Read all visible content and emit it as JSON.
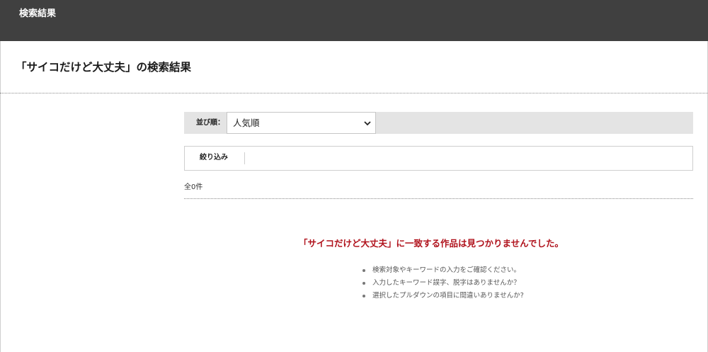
{
  "header": {
    "title": "検索結果"
  },
  "search": {
    "heading": "「サイコだけど大丈夫」の検索結果"
  },
  "sort": {
    "label": "並び順：",
    "selected": "人気順"
  },
  "filter": {
    "label": "絞り込み"
  },
  "results": {
    "count_text": "全0件",
    "no_result_message": "「サイコだけど大丈夫」に一致する作品は見つかりませんでした。",
    "tips": [
      "検索対象やキーワードの入力をご確認ください。",
      "入力したキーワード誤字、脱字はありませんか？",
      "選択したプルダウンの項目に間違いありませんか?"
    ]
  },
  "colors": {
    "header_bg": "#404040",
    "error_text": "#b0121c",
    "sort_bar_bg": "#e4e4e4"
  },
  "icons": {
    "select_chevron": "chevron-down-icon",
    "tip_bullet": "bullet-icon"
  }
}
